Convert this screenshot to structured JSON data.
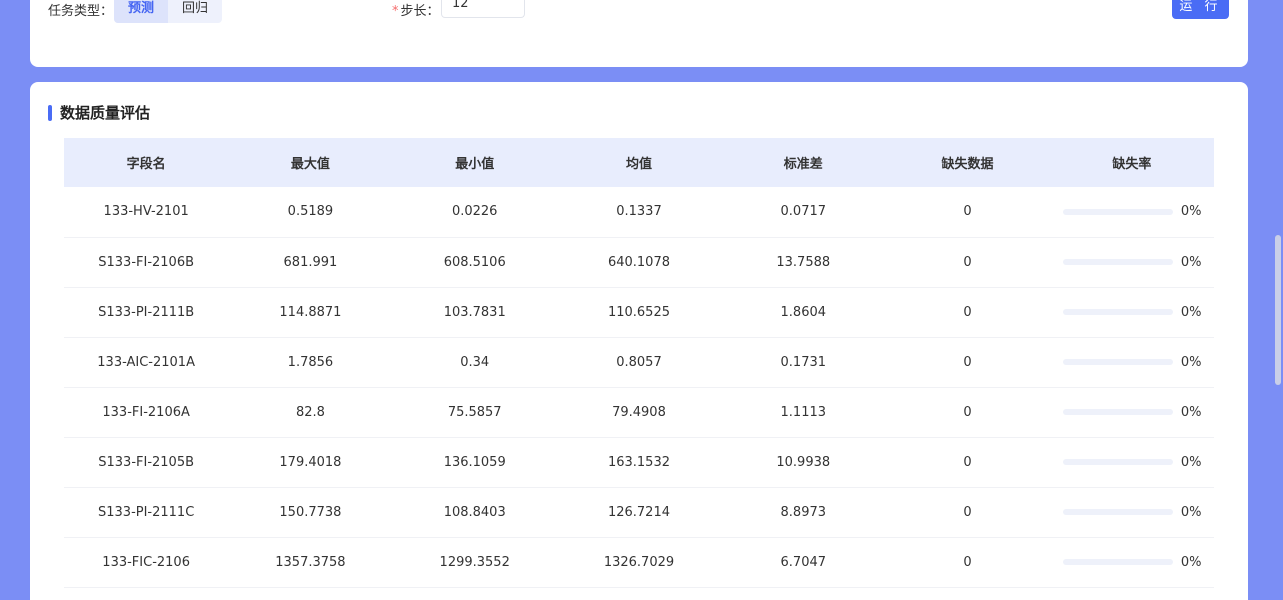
{
  "form": {
    "task_type_label": "任务类型：",
    "task_options": [
      "预测",
      "回归"
    ],
    "step_label": "步长：",
    "step_value": "12",
    "run_label": "运 行"
  },
  "section": {
    "title": "数据质量评估"
  },
  "table": {
    "headers": [
      "字段名",
      "最大值",
      "最小值",
      "均值",
      "标准差",
      "缺失数据",
      "缺失率"
    ],
    "rows": [
      {
        "name": "133-HV-2101",
        "max": "0.5189",
        "min": "0.0226",
        "mean": "0.1337",
        "std": "0.0717",
        "missing": "0",
        "rate": "0%",
        "rate_value": 0
      },
      {
        "name": "S133-FI-2106B",
        "max": "681.991",
        "min": "608.5106",
        "mean": "640.1078",
        "std": "13.7588",
        "missing": "0",
        "rate": "0%",
        "rate_value": 0
      },
      {
        "name": "S133-PI-2111B",
        "max": "114.8871",
        "min": "103.7831",
        "mean": "110.6525",
        "std": "1.8604",
        "missing": "0",
        "rate": "0%",
        "rate_value": 0
      },
      {
        "name": "133-AIC-2101A",
        "max": "1.7856",
        "min": "0.34",
        "mean": "0.8057",
        "std": "0.1731",
        "missing": "0",
        "rate": "0%",
        "rate_value": 0
      },
      {
        "name": "133-FI-2106A",
        "max": "82.8",
        "min": "75.5857",
        "mean": "79.4908",
        "std": "1.1113",
        "missing": "0",
        "rate": "0%",
        "rate_value": 0
      },
      {
        "name": "S133-FI-2105B",
        "max": "179.4018",
        "min": "136.1059",
        "mean": "163.1532",
        "std": "10.9938",
        "missing": "0",
        "rate": "0%",
        "rate_value": 0
      },
      {
        "name": "S133-PI-2111C",
        "max": "150.7738",
        "min": "108.8403",
        "mean": "126.7214",
        "std": "8.8973",
        "missing": "0",
        "rate": "0%",
        "rate_value": 0
      },
      {
        "name": "133-FIC-2106",
        "max": "1357.3758",
        "min": "1299.3552",
        "mean": "1326.7029",
        "std": "6.7047",
        "missing": "0",
        "rate": "0%",
        "rate_value": 0
      }
    ]
  }
}
